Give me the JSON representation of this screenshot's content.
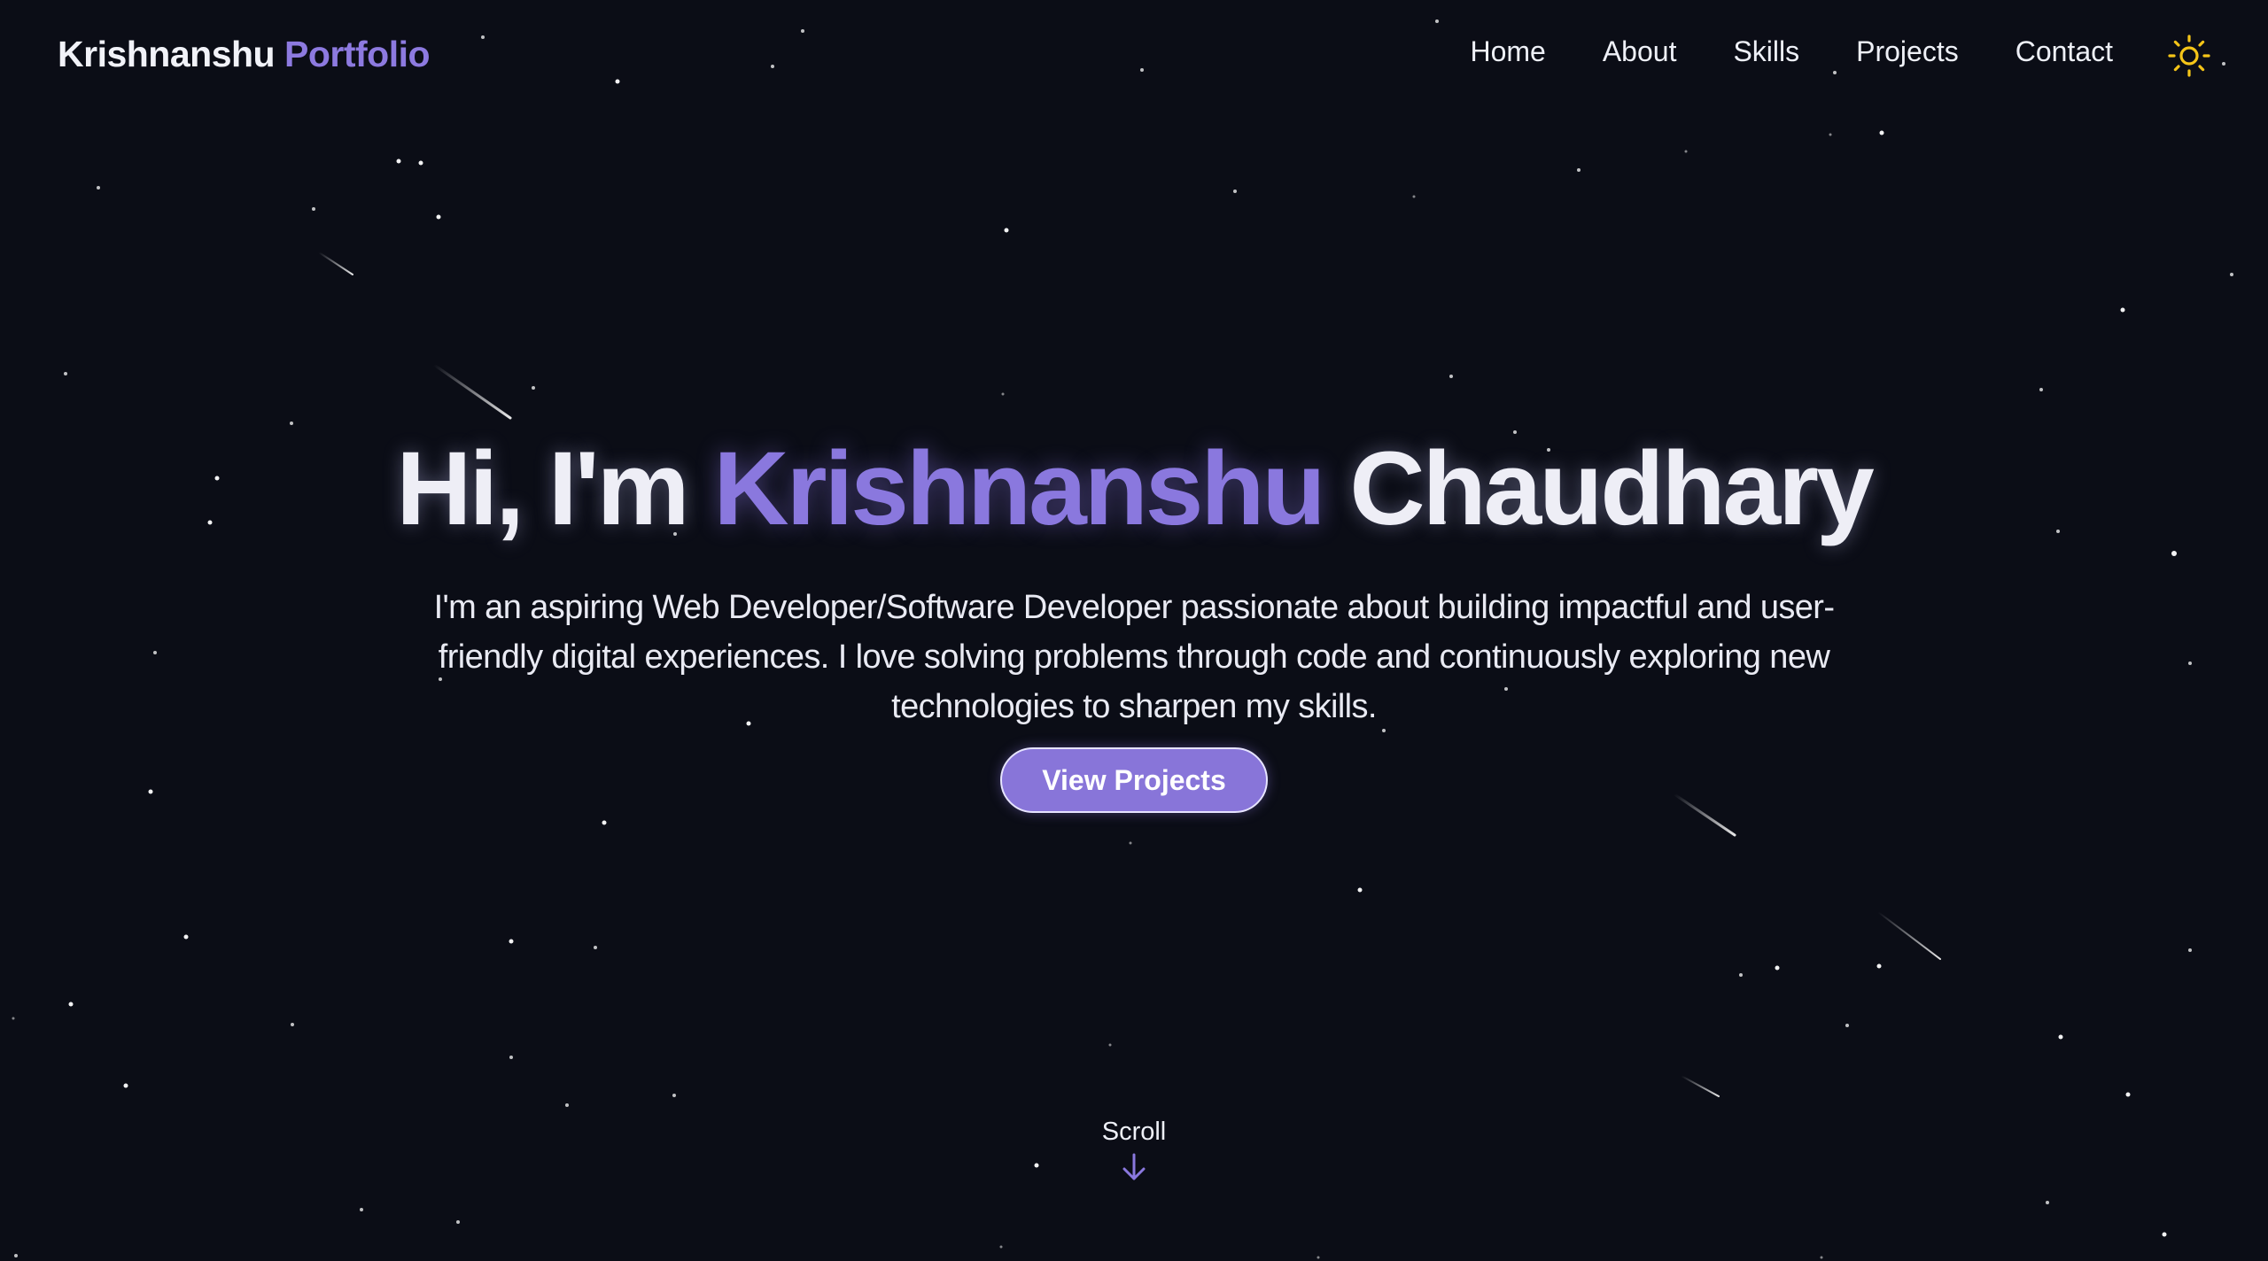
{
  "header": {
    "brand_first": "Krishnanshu",
    "brand_second": "Portfolio",
    "nav_items": [
      {
        "label": "Home"
      },
      {
        "label": "About"
      },
      {
        "label": "Skills"
      },
      {
        "label": "Projects"
      },
      {
        "label": "Contact"
      }
    ],
    "theme_toggle_icon": "sun-icon"
  },
  "hero": {
    "greeting": "Hi, I'm",
    "first_name": "Krishnanshu",
    "last_name": "Chaudhary",
    "description": "I'm an aspiring Web Developer/Software Developer passionate about building impactful and user-friendly digital experiences. I love solving problems through code and continuously exploring new technologies to sharpen my skills.",
    "cta_label": "View Projects"
  },
  "scroll_indicator": {
    "label": "Scroll",
    "icon": "arrow-down-icon"
  },
  "colors": {
    "background": "#0b0d16",
    "accent": "#8a78de",
    "button": "#8875d9",
    "text": "#eeeef6",
    "sun": "#f5c518"
  }
}
